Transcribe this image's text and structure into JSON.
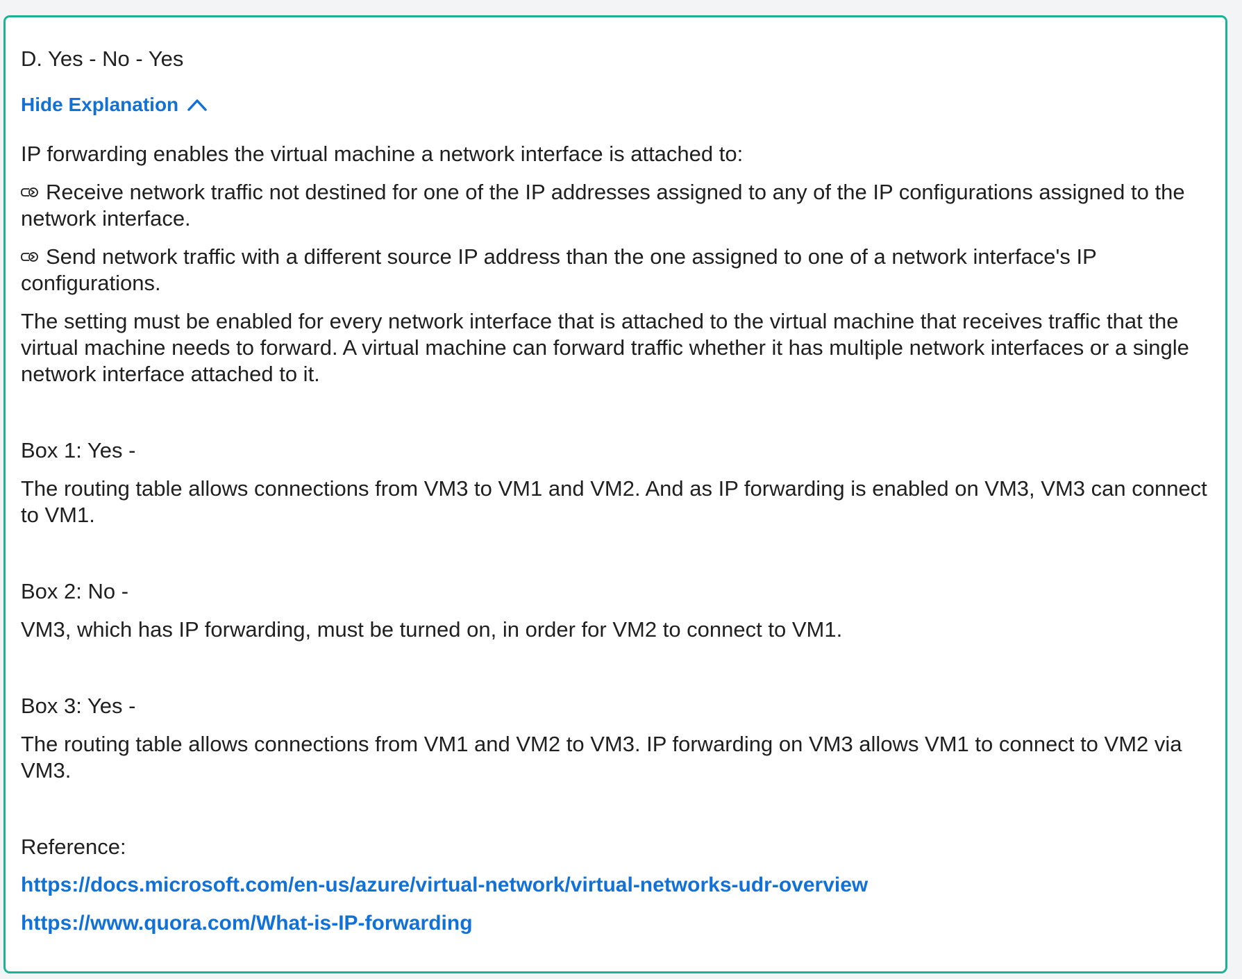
{
  "answer_option": "D. Yes - No - Yes",
  "toggle_label": "Hide Explanation",
  "explanation": {
    "intro": "IP forwarding enables the virtual machine a network interface is attached to:",
    "bullets": [
      "Receive network traffic not destined for one of the IP addresses assigned to any of the IP configurations assigned to the network interface.",
      "Send network traffic with a different source IP address than the one assigned to one of a network interface's IP configurations."
    ],
    "setting_note": "The setting must be enabled for every network interface that is attached to the virtual machine that receives traffic that the virtual machine needs to forward. A virtual machine can forward traffic whether it has multiple network interfaces or a single network interface attached to it.",
    "boxes": [
      {
        "heading": "Box 1: Yes -",
        "text": "The routing table allows connections from VM3 to VM1 and VM2. And as IP forwarding is enabled on VM3, VM3 can connect to VM1."
      },
      {
        "heading": "Box 2: No -",
        "text": "VM3, which has IP forwarding, must be turned on, in order for VM2 to connect to VM1."
      },
      {
        "heading": "Box 3: Yes -",
        "text": "The routing table allows connections from VM1 and VM2 to VM3. IP forwarding on VM3 allows VM1 to connect to VM2 via VM3."
      }
    ],
    "reference_label": "Reference:",
    "links": [
      "https://docs.microsoft.com/en-us/azure/virtual-network/virtual-networks-udr-overview",
      "https://www.quora.com/What-is-IP-forwarding"
    ]
  },
  "icons": {
    "toggle": "chevron-up-icon",
    "bullet": "arrow-bullet-icon"
  },
  "colors": {
    "card_border": "#1bb394",
    "link": "#1271d6",
    "text": "#1f1f1f",
    "page_background": "#f3f4f6"
  }
}
